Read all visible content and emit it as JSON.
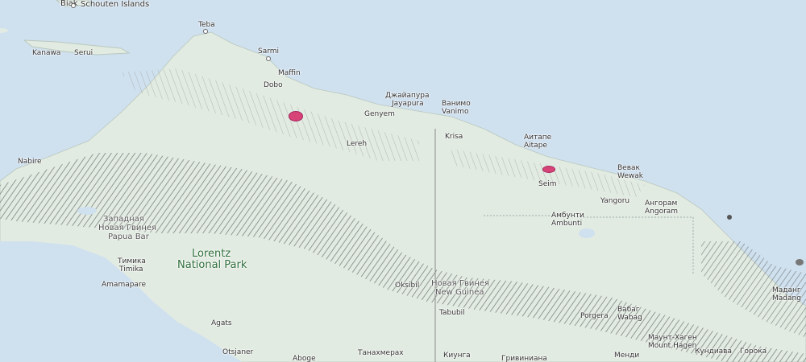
{
  "map": {
    "colors": {
      "sea": "#cfe0ef",
      "land": "#e2ebe2",
      "relief": "#8a8f8c",
      "range_highlight": "#d6336c"
    },
    "labels": {
      "schouten": "Schouten Islands",
      "biak": "Biak",
      "teba": "Teba",
      "kanawa": "Kanawa",
      "serui": "Serui",
      "sarmi": "Sarmi",
      "maffin": "Maffin",
      "dobo": "Dobo",
      "jayapura_ru": "Джайапура",
      "jayapura": "Jayapura",
      "genyem": "Genyem",
      "vanimo_ru": "Ванимо",
      "vanimo": "Vanimo",
      "krisa": "Krisa",
      "aitape_ru": "Аитапе",
      "aitape": "Aitape",
      "wewak_ru": "Вевак",
      "wewak": "Wewak",
      "seim": "Seim",
      "yangoru": "Yangoru",
      "angoram_ru": "Ангорам",
      "angoram": "Angoram",
      "ambunti_ru": "Амбунти",
      "ambunti": "Ambunti",
      "nabire": "Nabire",
      "lereh": "Lereh",
      "wpapua_ru": "Западная",
      "wpapua_ru2": "Новая Гвинея",
      "wpapua": "Papua Bar",
      "timika_ru": "Тимика",
      "timika": "Timika",
      "amamapare": "Amamapare",
      "lorentz1": "Lorentz",
      "lorentz2": "National Park",
      "oksibil": "Oksibil",
      "png_ru": "Новая Гвинея",
      "png": "New Guinea",
      "tabubil": "Tabubil",
      "agats": "Agats",
      "otsjaner": "Otsjaner",
      "aboge": "Aboge",
      "tanah_ru": "Танахмерах",
      "kiunga_ru": "Киунга",
      "griv_ru": "Гривиниана",
      "mendi_ru": "Менди",
      "hagen_ru": "Маунт-Хаген",
      "hagen": "Mount Hagen",
      "wabag_ru": "Вабаг",
      "wabag": "Wabag",
      "porgera": "Porgera",
      "madang_ru": "Маданг",
      "madang": "Madang",
      "kundiawa_ru": "Кундиава",
      "goroka_ru": "Горока"
    }
  }
}
